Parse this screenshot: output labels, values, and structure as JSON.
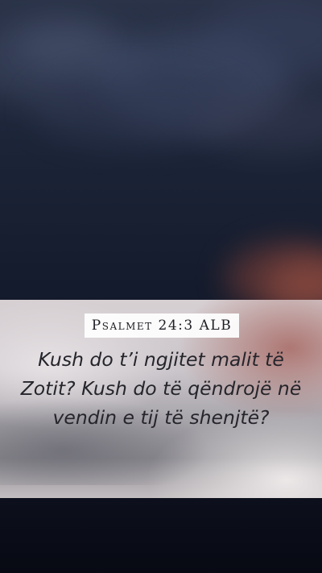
{
  "verse_card": {
    "reference": "Psalmet 24:3 ALB",
    "text": "Kush do t’i ngjitet malit të Zotit? Kush do të qëndrojë në vendin e tij të shenjtë?"
  }
}
